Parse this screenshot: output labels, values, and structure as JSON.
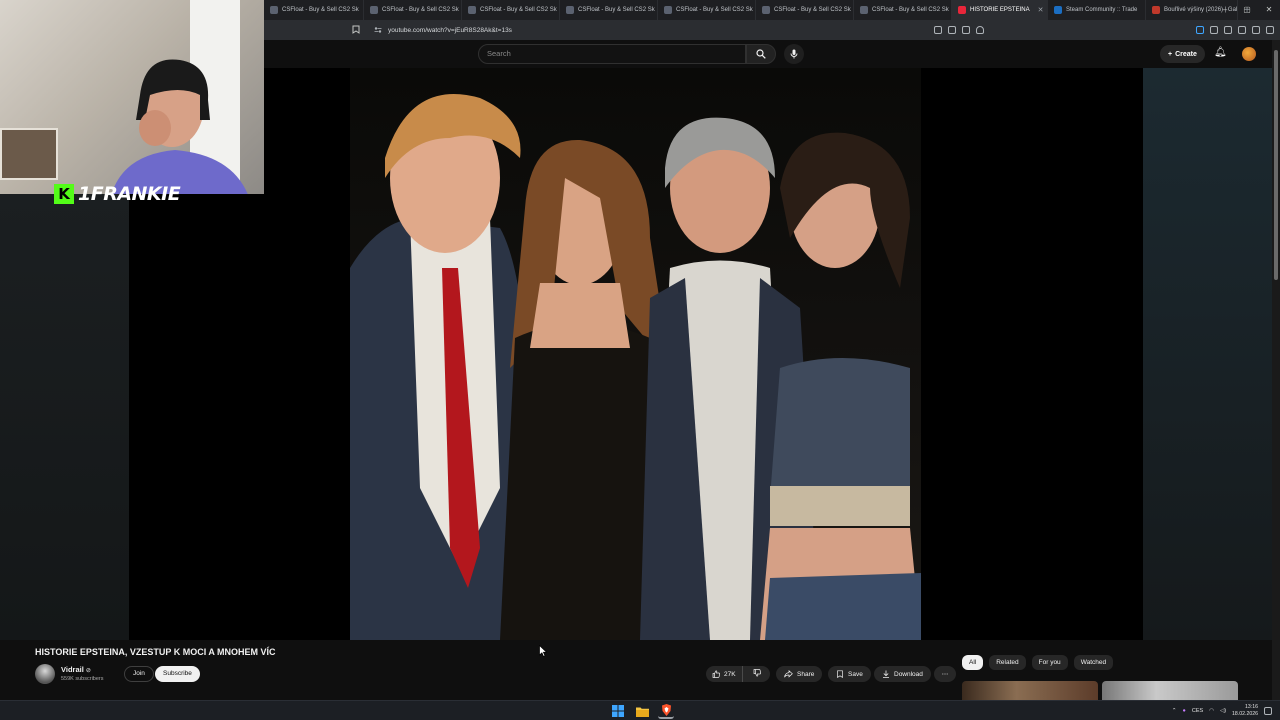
{
  "browser": {
    "tabs": [
      {
        "label": "CSFloat - Buy & Sell CS2 Sk",
        "active": false
      },
      {
        "label": "CSFloat - Buy & Sell CS2 Sk",
        "active": false
      },
      {
        "label": "CSFloat - Buy & Sell CS2 Sk",
        "active": false
      },
      {
        "label": "CSFloat - Buy & Sell CS2 Sk",
        "active": false
      },
      {
        "label": "CSFloat - Buy & Sell CS2 Sk",
        "active": false
      },
      {
        "label": "CSFloat - Buy & Sell CS2 Sk",
        "active": false
      },
      {
        "label": "CSFloat - Buy & Sell CS2 Sk",
        "active": false
      },
      {
        "label": "HISTORIE EPSTEINA",
        "active": true
      },
      {
        "label": "Steam Community :: Trade",
        "active": false
      },
      {
        "label": "Bouřlivé výšiny (2026) | Gal",
        "active": false
      }
    ],
    "new_tab": "+",
    "window_controls": [
      "–",
      "▢",
      "✕"
    ],
    "url": "youtube.com/watch?v=jEuR8S28Ak&t=13s"
  },
  "youtube": {
    "search_placeholder": "Search",
    "create_label": "Create"
  },
  "streamer": {
    "badge": "K",
    "name": "1FRANKIE"
  },
  "video": {
    "title": "HISTORIE EPSTEINA, VZESTUP K MOCI A MNOHEM VÍC",
    "channel": "Vidrail",
    "verified": "⊘",
    "subscribers": "559K subscribers",
    "join_label": "Join",
    "subscribe_label": "Subscribe",
    "likes": "27K",
    "share_label": "Share",
    "save_label": "Save",
    "download_label": "Download",
    "more_label": "⋯"
  },
  "sidebar": {
    "chips": [
      {
        "label": "All",
        "selected": true
      },
      {
        "label": "Related",
        "selected": false
      },
      {
        "label": "For you",
        "selected": false
      },
      {
        "label": "Watched",
        "selected": false
      }
    ]
  },
  "taskbar": {
    "language": "CES",
    "time": "13:16",
    "date": "18.02.2026"
  },
  "colors": {
    "brand_red": "#e8263a",
    "kick_green": "#53fc18",
    "yt_bg": "#0f0f0f"
  }
}
